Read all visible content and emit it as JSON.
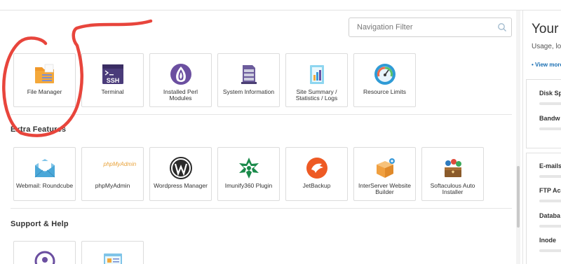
{
  "search": {
    "placeholder": "Navigation Filter"
  },
  "tools_row": [
    {
      "label": "File Manager",
      "icon": "folder-icon"
    },
    {
      "label": "Terminal",
      "icon": "ssh-terminal-icon"
    },
    {
      "label": "Installed Perl Modules",
      "icon": "perl-onion-icon"
    },
    {
      "label": "System Information",
      "icon": "server-icon"
    },
    {
      "label": "Site Summary / Statistics / Logs",
      "icon": "statistics-icon"
    },
    {
      "label": "Resource Limits",
      "icon": "gauge-icon"
    }
  ],
  "extra_features": {
    "title": "Extra Features",
    "items": [
      {
        "label": "Webmail: Roundcube",
        "icon": "webmail-icon"
      },
      {
        "label": "phpMyAdmin",
        "icon": "phpmyadmin-icon",
        "logo_text": "phpMyAdmin"
      },
      {
        "label": "Wordpress Manager",
        "icon": "wordpress-icon"
      },
      {
        "label": "Imunify360 Plugin",
        "icon": "imunify360-icon"
      },
      {
        "label": "JetBackup",
        "icon": "jetbackup-icon"
      },
      {
        "label": "InterServer Website Builder",
        "icon": "website-builder-icon"
      },
      {
        "label": "Softaculous Auto Installer",
        "icon": "softaculous-icon"
      }
    ]
  },
  "support": {
    "title": "Support & Help",
    "items": [
      {
        "icon": "support-chat-icon"
      },
      {
        "icon": "knowledgebase-icon"
      }
    ]
  },
  "sidebar": {
    "title": "Your A",
    "subtitle": "Usage, log",
    "link": "• View more",
    "stats": [
      "Disk Sp",
      "Bandw",
      "E-mails",
      "FTP Acc",
      "Databa",
      "Inode"
    ]
  },
  "colors": {
    "annotation": "#e8453c",
    "link": "#1a6fb3",
    "folder": "#f4a83a",
    "ssh": "#4a3b7a",
    "jetbackup": "#ee5a24",
    "imunify": "#1a8a4a"
  }
}
